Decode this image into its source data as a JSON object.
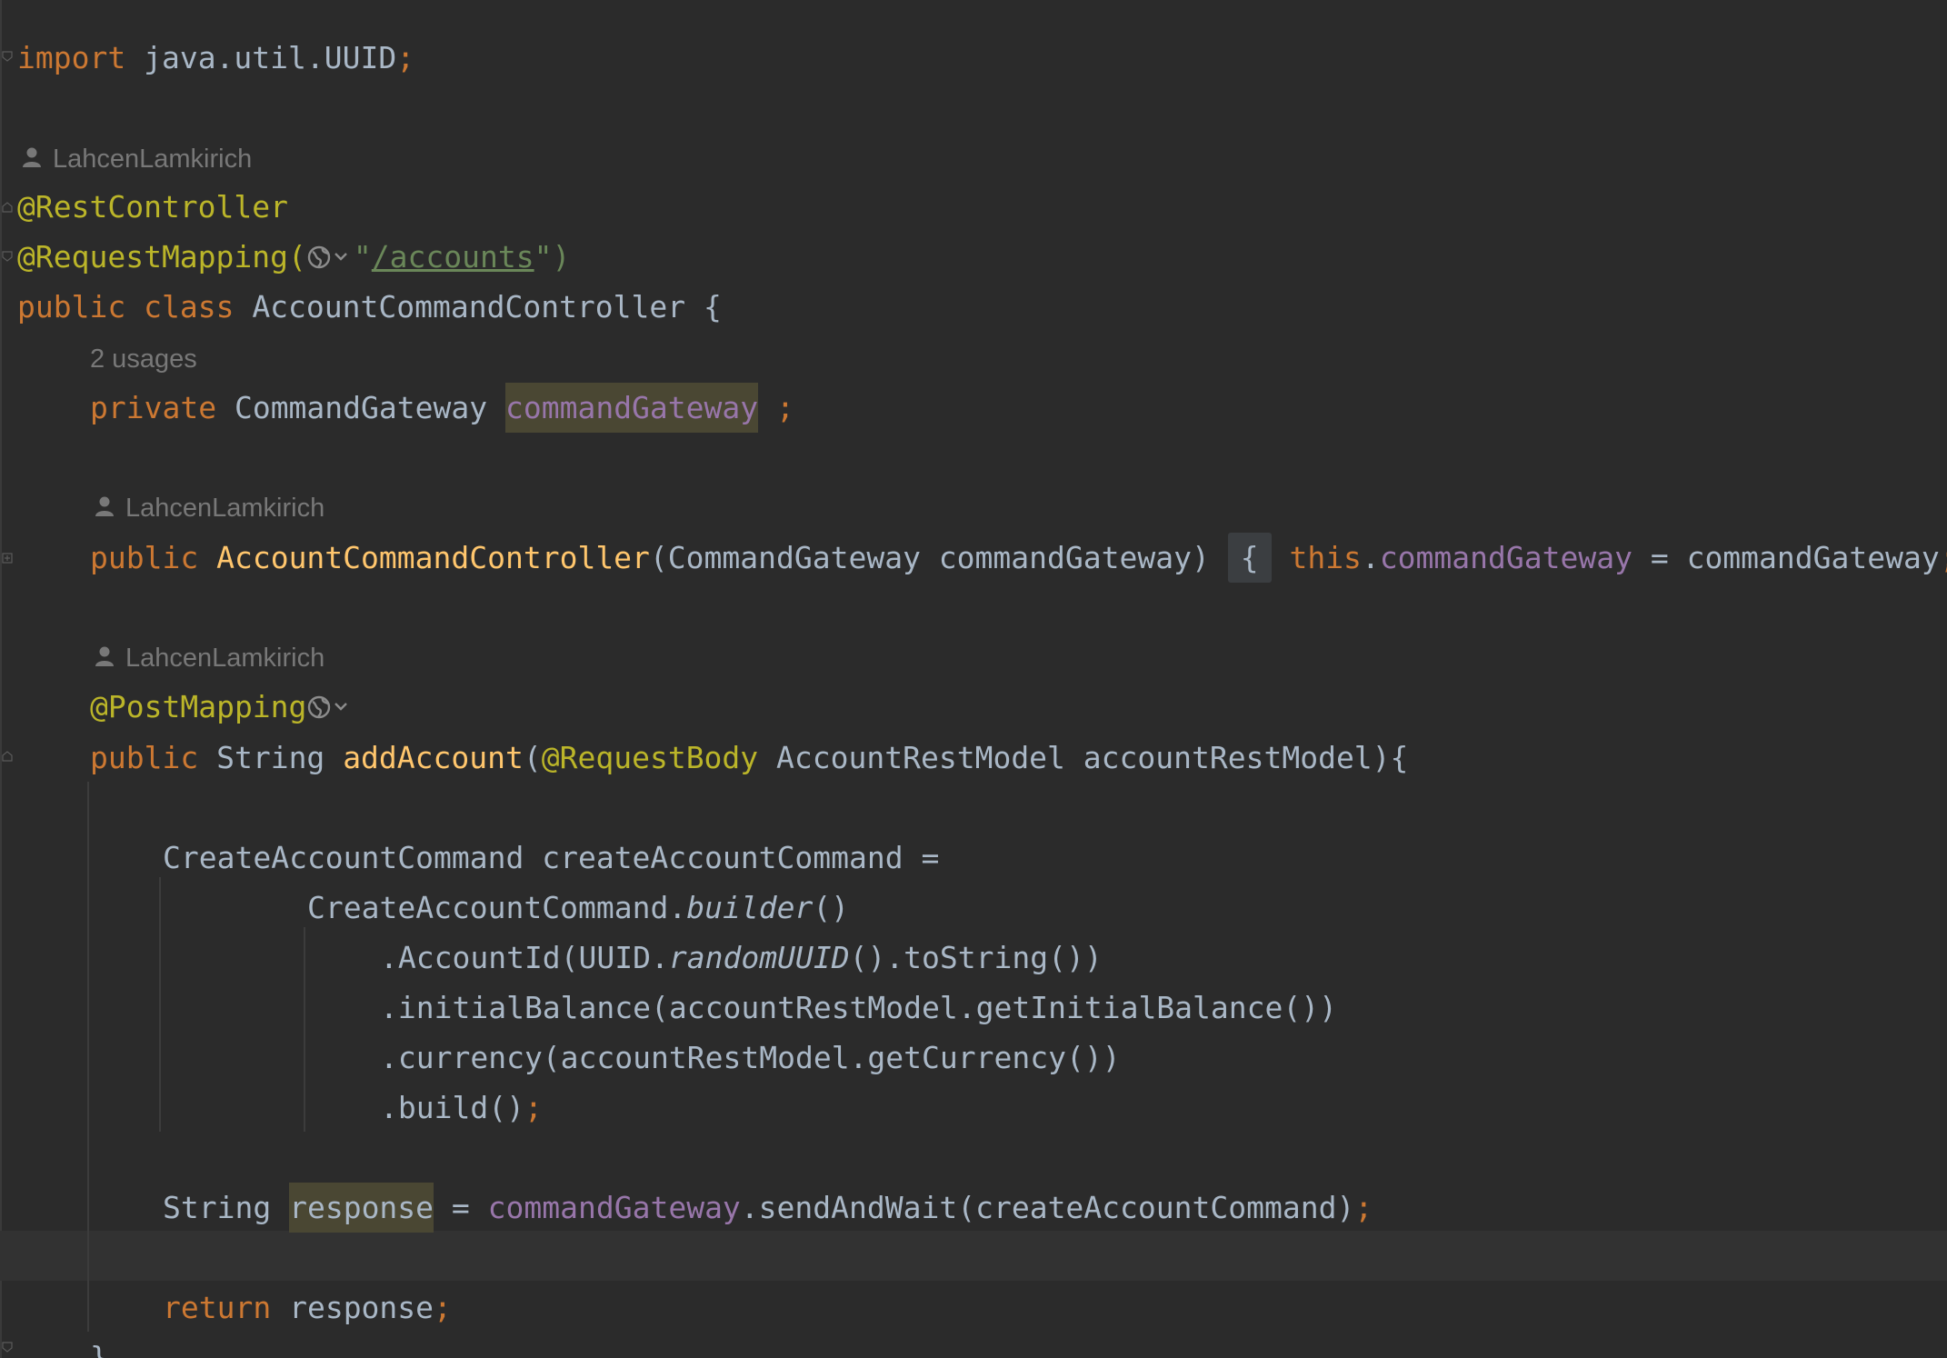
{
  "editor": {
    "language": "java",
    "colors": {
      "background": "#2b2b2b",
      "keyword": "#cc7832",
      "annotation": "#bbb529",
      "method_decl": "#ffc66d",
      "field": "#9876aa",
      "string": "#6a8759",
      "default": "#a9b7c6",
      "hint": "#787878",
      "highlight": "#4a4733"
    },
    "code": {
      "import_kw": "import",
      "import_path": " java.util.UUID",
      "semi": ";",
      "author_1": "LahcenLamkirich",
      "author_2": "LahcenLamkirich",
      "author_3": "LahcenLamkirich",
      "ann_rest_controller": "@RestController",
      "ann_request_mapping": "@RequestMapping(",
      "quote_open": "\"",
      "mapping_path": "/accounts",
      "quote_close": "\")",
      "public_kw": "public",
      "class_kw": "class",
      "class_name": "AccountCommandController {",
      "usages_hint": "2 usages",
      "private_kw": "private",
      "gateway_type": "CommandGateway",
      "gateway_field": "commandGateway",
      "field_semi": " ;",
      "ctor_public_kw": "public",
      "ctor_name": "AccountCommandController",
      "ctor_params": "(CommandGateway commandGateway)",
      "brace_open": "{",
      "this_kw": "this",
      "dot": ".",
      "this_field": "commandGateway",
      "assign_rhs": " = commandGateway",
      "ctor_semi": ";",
      "ann_post_mapping": "@PostMapping",
      "method_public_kw": "public",
      "method_return": "String",
      "method_name": "addAccount",
      "paren_open": "(",
      "ann_request_body": "@RequestBody",
      "method_params": " AccountRestModel accountRestModel){",
      "cmd_decl": "CreateAccountCommand createAccountCommand =",
      "builder_recv": "CreateAccountCommand.",
      "builder_call": "builder",
      "builder_parens": "()",
      "account_id_pre": ".AccountId(UUID.",
      "random_uuid": "randomUUID",
      "account_id_post": "().toString())",
      "initial_balance": ".initialBalance(accountRestModel.getInitialBalance())",
      "currency": ".currency(accountRestModel.getCurrency())",
      "build_call": ".build()",
      "build_semi": ";",
      "string_type": "String",
      "response_var": "response",
      "assign_eq": " = ",
      "gateway_ref": "commandGateway",
      "send_call": ".sendAndWait(createAccountCommand)",
      "send_semi": ";",
      "return_kw": "return",
      "return_val": " response",
      "return_semi": ";",
      "closing_brace": "}"
    },
    "icons": {
      "author": "user-icon",
      "route": "globe-icon",
      "fold": "fold-marker-icon"
    }
  }
}
